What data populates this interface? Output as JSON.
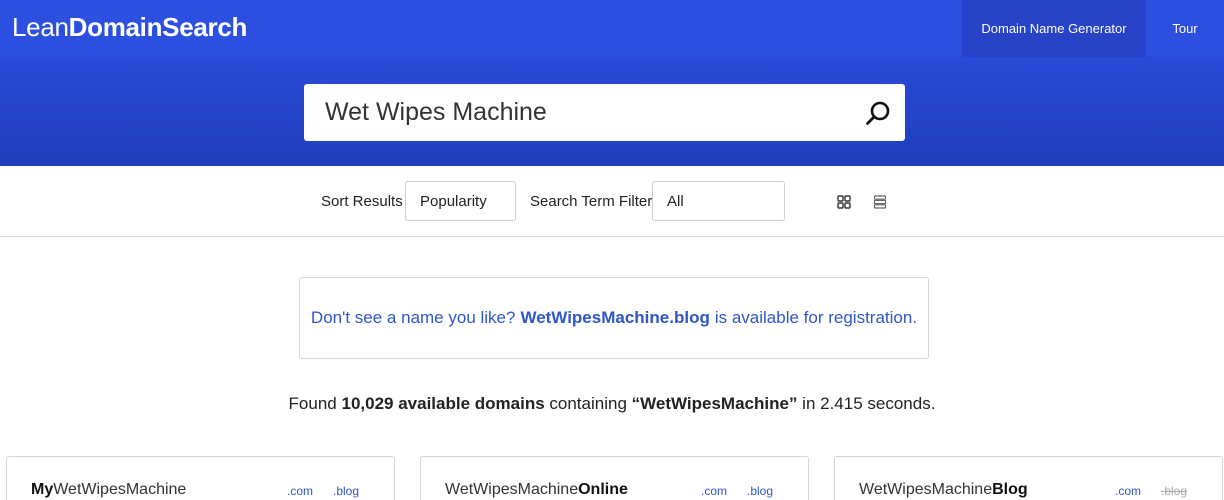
{
  "header": {
    "logo_light": "Lean",
    "logo_bold": "DomainSearch",
    "nav": [
      {
        "label": "Domain Name Generator"
      },
      {
        "label": "Tour"
      }
    ]
  },
  "search": {
    "value": "Wet Wipes Machine",
    "icon": "search-icon"
  },
  "filters": {
    "sort_label": "Sort Results",
    "sort_value": "Popularity",
    "term_label": "Search Term Filter",
    "term_value": "All",
    "view_icons": [
      "grid-view-icon",
      "list-view-icon"
    ]
  },
  "notice": {
    "prefix": "Don't see a name you like?",
    "domain": "WetWipesMachine.blog",
    "suffix": "is available for registration."
  },
  "found": {
    "prefix": "Found",
    "count": "10,029 available domains",
    "middle": "containing",
    "term": "“WetWipesMachine”",
    "suffix": "in 2.415 seconds."
  },
  "results": [
    {
      "bold_prefix": "My",
      "base": "WetWipesMachine",
      "bold_suffix": "",
      "com": ".com",
      "blog": ".blog",
      "blog_taken": false
    },
    {
      "bold_prefix": "",
      "base": "WetWipesMachine",
      "bold_suffix": "Online",
      "com": ".com",
      "blog": ".blog",
      "blog_taken": false
    },
    {
      "bold_prefix": "",
      "base": "WetWipesMachine",
      "bold_suffix": "Blog",
      "com": ".com",
      "blog": ".blog",
      "blog_taken": true
    }
  ],
  "colors": {
    "brand": "#2c4fe0",
    "link": "#2e57c7"
  }
}
